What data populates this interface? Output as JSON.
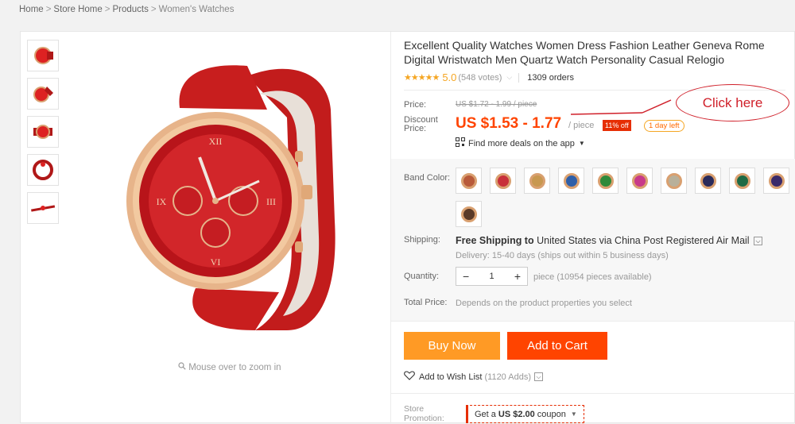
{
  "breadcrumb": {
    "items": [
      "Home",
      "Store Home",
      "Products"
    ],
    "current": "Women's Watches",
    "separator": ">"
  },
  "gallery": {
    "thumbnail_count": 5,
    "zoom_hint": "Mouse over to zoom in"
  },
  "product": {
    "title": "Excellent Quality Watches Women Dress Fashion Leather Geneva Rome Digital Wristwatch Men Quartz Watch Personality Casual Relogio",
    "stars": "★★★★★",
    "rating": "5.0",
    "votes": "(548 votes)",
    "orders": "1309 orders"
  },
  "pricing": {
    "price_label": "Price:",
    "old_price": "US $1.72 - 1.99 / piece",
    "discount_label_1": "Discount",
    "discount_label_2": "Price:",
    "price": "US $1.53 - 1.77",
    "per_piece": "/ piece",
    "off_badge": "11% off",
    "day_badge": "1 day left",
    "deals_link": "Find more deals on the app"
  },
  "annotation": {
    "text": "Click here"
  },
  "band": {
    "label": "Band Color:",
    "swatches": [
      "#b85a3a",
      "#c8303a",
      "#c89850",
      "#2f5fa8",
      "#2f8a3a",
      "#c83a8a",
      "#b8b09a",
      "#2a2a5a",
      "#1f6a44",
      "#3a2a6a",
      "#5a3a28"
    ]
  },
  "shipping": {
    "label": "Shipping:",
    "prefix": "Free Shipping to",
    "destination": "United States via China Post Registered Air Mail",
    "delivery": "Delivery: 15-40 days (ships out within 5 business days)"
  },
  "quantity": {
    "label": "Quantity:",
    "minus": "−",
    "value": "1",
    "plus": "+",
    "available": "piece (10954 pieces available)"
  },
  "total": {
    "label": "Total Price:",
    "value": "Depends on the product properties you select"
  },
  "actions": {
    "buy_now": "Buy Now",
    "add_to_cart": "Add to Cart",
    "wishlist": "Add to Wish List",
    "wishlist_count": "(1120 Adds)"
  },
  "promotion": {
    "label_1": "Store",
    "label_2": "Promotion:",
    "coupon_pre": "Get a",
    "coupon_amount": "US $2.00",
    "coupon_post": "coupon"
  },
  "colors": {
    "accent": "#ff4400",
    "buy_button": "#ff9a25",
    "star": "#f5a623",
    "annotation": "#d0202a"
  }
}
